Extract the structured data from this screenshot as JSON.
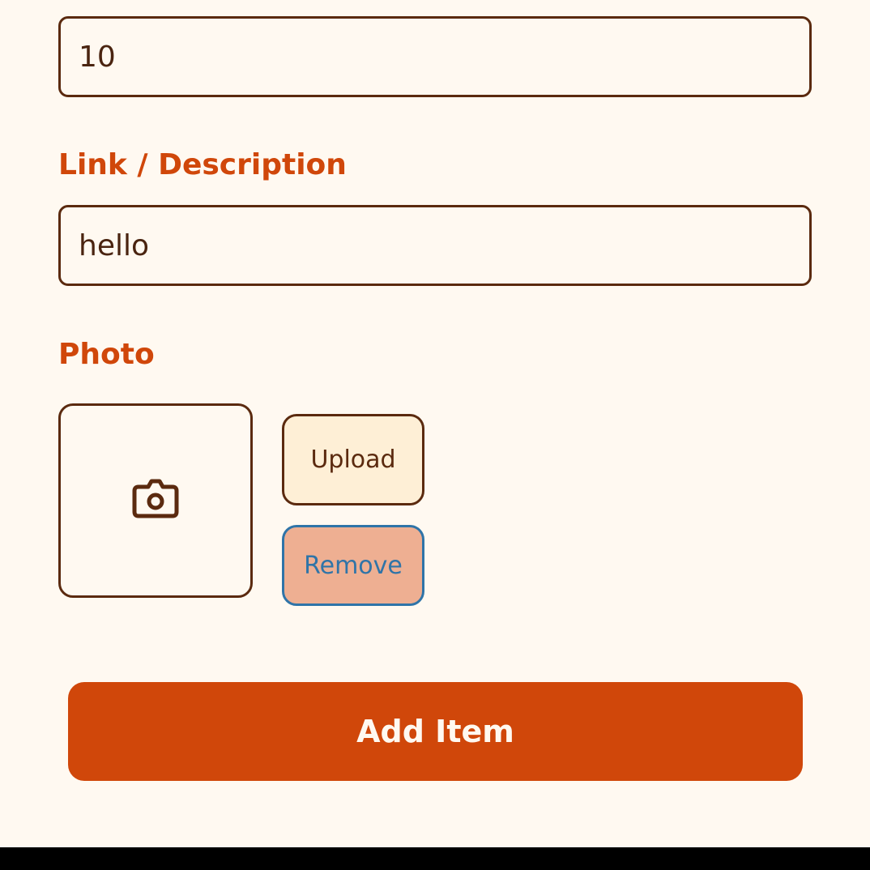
{
  "form": {
    "quantity_value": "10",
    "description_label": "Link / Description",
    "description_value": "hello",
    "photo_label": "Photo",
    "upload_label": "Upload",
    "remove_label": "Remove",
    "submit_label": "Add Item"
  },
  "icons": {
    "photo_placeholder": "camera-icon"
  },
  "colors": {
    "background": "#FFF9F1",
    "accent": "#D0470A",
    "border": "#5B2A0F",
    "upload_bg": "#FEEFD6",
    "remove_bg": "#EEAF92",
    "remove_text": "#2F74A8"
  }
}
